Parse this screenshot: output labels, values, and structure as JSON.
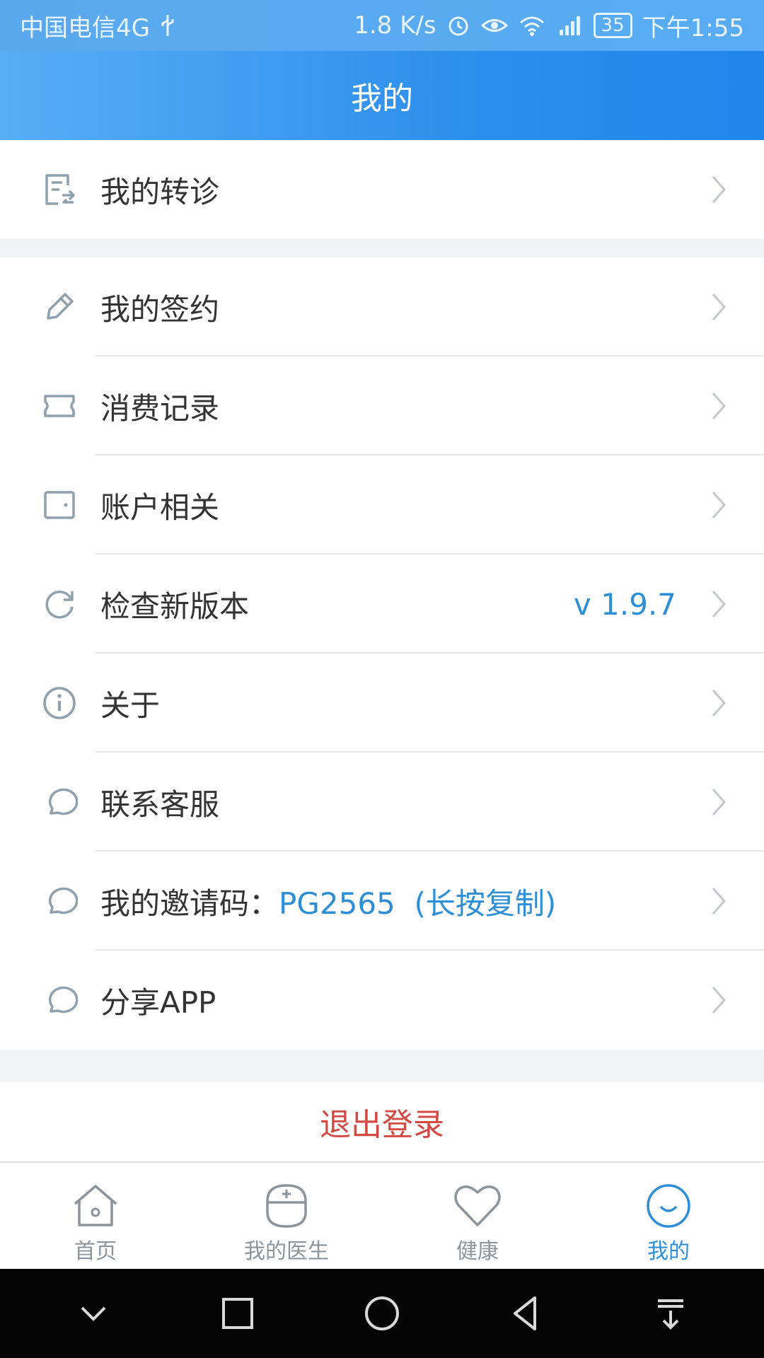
{
  "status": {
    "carrier": "中国电信4G",
    "speed": "1.8 K/s",
    "battery": "35",
    "time": "下午1:55"
  },
  "header": {
    "title": "我的"
  },
  "menu": {
    "referral": {
      "label": "我的转诊"
    },
    "items": [
      {
        "label": "我的签约",
        "icon": "pencil-icon"
      },
      {
        "label": "消费记录",
        "icon": "ticket-icon"
      },
      {
        "label": "账户相关",
        "icon": "wallet-icon"
      },
      {
        "label": "检查新版本",
        "icon": "refresh-icon",
        "value": "v 1.9.7"
      },
      {
        "label": "关于",
        "icon": "info-icon"
      },
      {
        "label": "联系客服",
        "icon": "chat-icon"
      },
      {
        "label": "我的邀请码：",
        "icon": "chat-icon",
        "code": "PG2565",
        "hint": "(长按复制)"
      },
      {
        "label": "分享APP",
        "icon": "chat-icon"
      }
    ]
  },
  "logout": {
    "label": "退出登录"
  },
  "tabs": [
    {
      "label": "首页",
      "icon": "home-icon"
    },
    {
      "label": "我的医生",
      "icon": "doctor-icon"
    },
    {
      "label": "健康",
      "icon": "heart-icon"
    },
    {
      "label": "我的",
      "icon": "smile-icon",
      "active": true
    }
  ],
  "colors": {
    "accent": "#2e8fd6",
    "header": "#2d8fec",
    "logout": "#d24a43"
  }
}
